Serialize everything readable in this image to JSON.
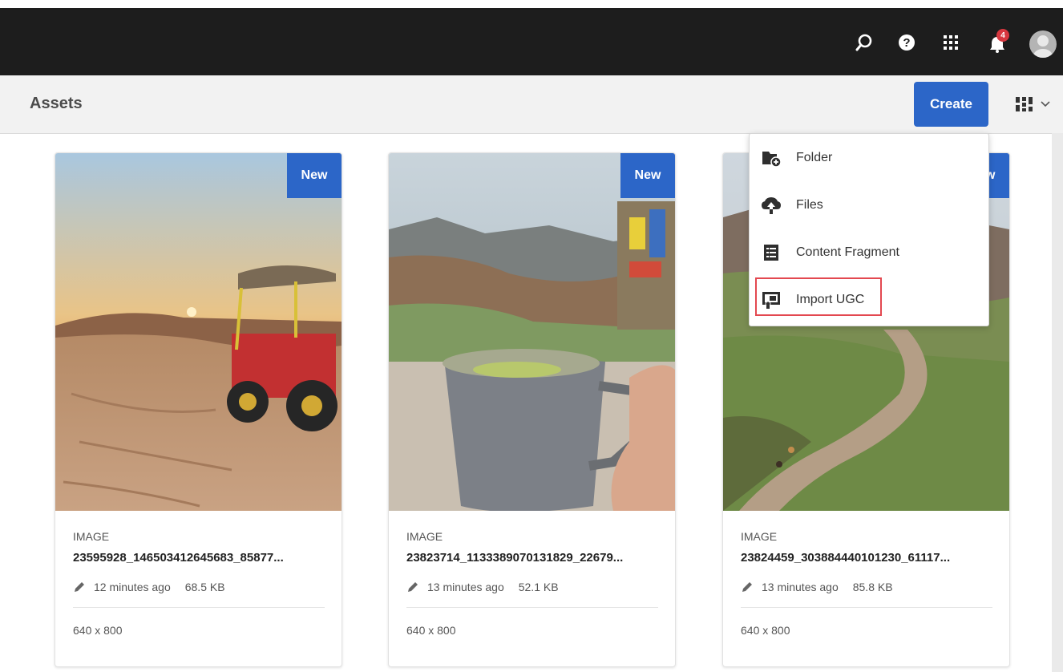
{
  "header": {
    "notification_count": "4",
    "icons": [
      "search-icon",
      "help-icon",
      "apps-grid-icon",
      "notification-bell-icon",
      "user-avatar"
    ]
  },
  "actionbar": {
    "title": "Assets",
    "create_label": "Create",
    "view_icon": "column-view-icon"
  },
  "create_menu": {
    "items": [
      {
        "label": "Folder",
        "icon": "folder-add-icon"
      },
      {
        "label": "Files",
        "icon": "cloud-upload-icon"
      },
      {
        "label": "Content Fragment",
        "icon": "content-fragment-icon"
      },
      {
        "label": "Import UGC",
        "icon": "import-ugc-icon"
      }
    ],
    "highlighted_item": "Import UGC"
  },
  "cards": [
    {
      "badge": "New",
      "type": "IMAGE",
      "name": "23595928_146503412645683_85877...",
      "modified": "12 minutes ago",
      "size": "68.5 KB",
      "dimensions": "640 x 800"
    },
    {
      "badge": "New",
      "type": "IMAGE",
      "name": "23823714_1133389070131829_22679...",
      "modified": "13 minutes ago",
      "size": "52.1 KB",
      "dimensions": "640 x 800"
    },
    {
      "badge": "New",
      "type": "IMAGE",
      "name": "23824459_303884440101230_61117...",
      "modified": "13 minutes ago",
      "size": "85.8 KB",
      "dimensions": "640 x 800"
    }
  ],
  "colors": {
    "topbar": "#1d1d1d",
    "accent": "#2c66c8",
    "highlight": "#e34850",
    "badge_red": "#d7373f"
  }
}
